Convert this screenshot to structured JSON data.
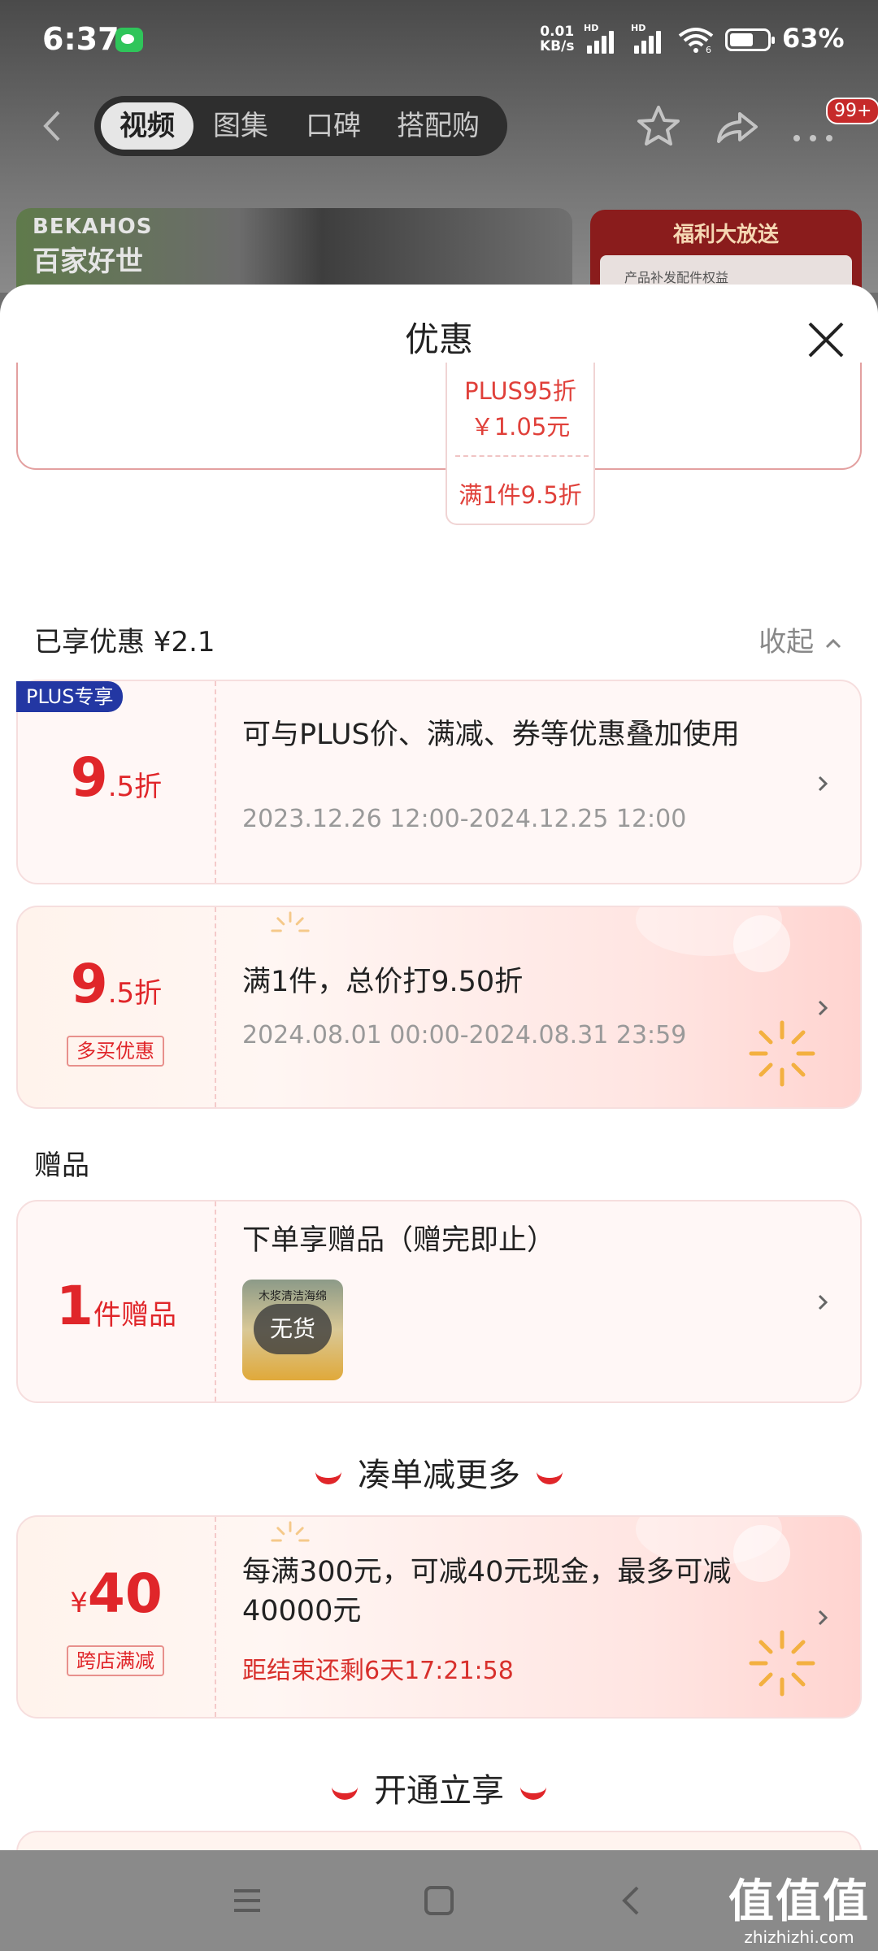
{
  "status_bar": {
    "time": "6:37",
    "net_speed_value": "0.01",
    "net_speed_unit": "KB/s",
    "signal_label": "HD",
    "wifi_label": "6",
    "battery": "63%"
  },
  "nav": {
    "tabs": [
      "视频",
      "图集",
      "口碑",
      "搭配购"
    ],
    "active_tab": 0,
    "badge": "99+"
  },
  "background": {
    "brand_en": "BEKAHOS",
    "brand_cn": "百家好世",
    "welfare_title": "福利大放送",
    "welfare_sub": "产品补发配件权益"
  },
  "sheet": {
    "title": "优惠",
    "plus_price": {
      "line1": "PLUS95折",
      "line2": "￥1.05元",
      "line3": "满1件9.5折"
    },
    "enjoyed_label": "已享优惠 ¥2.1",
    "collapse_label": "收起",
    "offers": [
      {
        "badge": "PLUS专享",
        "num": "9",
        "unit": ".5折",
        "title": "可与PLUS价、满减、券等优惠叠加使用",
        "period": "2023.12.26 12:00-2024.12.25 12:00"
      },
      {
        "num": "9",
        "unit": ".5折",
        "tag": "多买优惠",
        "title": "满1件，总价打9.50折",
        "period": "2024.08.01 00:00-2024.08.31 23:59"
      }
    ],
    "gift_section": "赠品",
    "gift": {
      "num": "1",
      "unit": "件赠品",
      "title": "下单享赠品（赠完即止）",
      "thumb_text": "木浆清洁海绵",
      "status": "无货"
    },
    "more_heading": "凑单减更多",
    "cross_store": {
      "currency": "¥",
      "num": "40",
      "tag": "跨店满减",
      "title": "每满300元，可减40元现金，最多可减40000元",
      "countdown": "距结束还剩6天17:21:58"
    },
    "open_heading": "开通立享"
  },
  "watermark": {
    "big": "值值值",
    "small": "zhizhizhi.com"
  },
  "colors": {
    "accent_red": "#e0262a",
    "plus_blue": "#2337a3",
    "card_bg": "#fff7f6"
  }
}
